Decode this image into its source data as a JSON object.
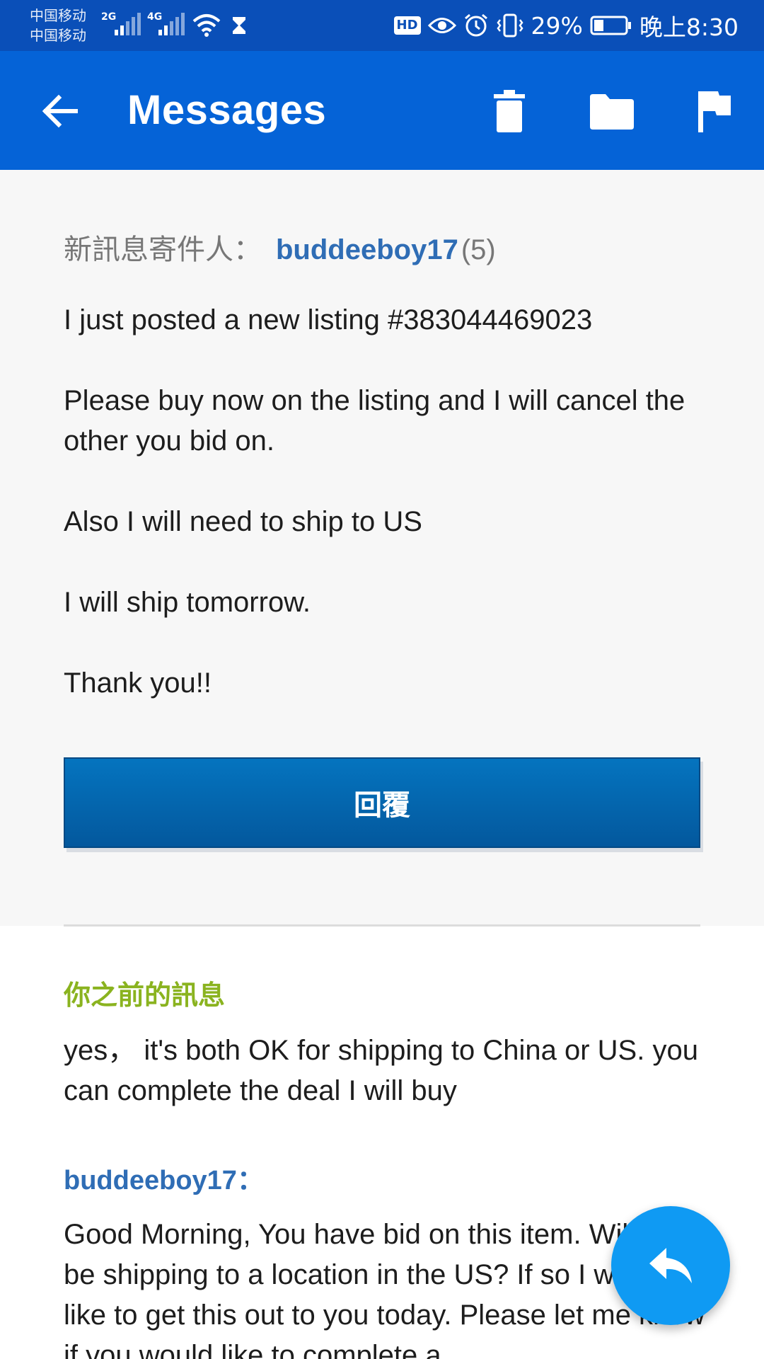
{
  "status_bar": {
    "carrier_1": "中国移动",
    "carrier_2": "中国移动",
    "network_1": "2G",
    "network_2": "4G",
    "hd_label": "HD",
    "battery": "29%",
    "time": "晚上8:30",
    "icons": [
      "signal-icon",
      "wifi-icon",
      "hourglass-icon",
      "eye-icon",
      "alarm-icon",
      "vibrate-icon",
      "battery-icon"
    ]
  },
  "app_bar": {
    "title": "Messages",
    "actions": [
      "back-arrow-icon",
      "trash-icon",
      "folder-icon",
      "flag-icon"
    ],
    "color": "#0563d7"
  },
  "message": {
    "sender_label": "新訊息寄件人：",
    "sender_name": "buddeeboy17",
    "sender_score": "(5)",
    "paragraphs": [
      "I just posted a new listing #383044469023",
      "Please buy now on the listing and I will cancel the other you bid on.",
      "Also I will need to ship to US",
      "I will ship tomorrow.",
      "Thank you!!"
    ],
    "reply_button": "回覆"
  },
  "history": {
    "previous_label": "你之前的訊息",
    "previous_text": "yes， it's both OK for shipping to China or US. you can complete the deal I will buy",
    "sender": "buddeeboy17：",
    "text": "Good Morning, You have bid on this item. Will you be shipping to a location in the US? If so I would like to get this out to you today. Please let me know if you would like to complete a"
  },
  "fab": {
    "icon": "reply-icon",
    "color": "#0f9af3"
  },
  "colors": {
    "status_bar": "#0a4fb8",
    "link_blue": "#2f6db5",
    "previous_label_green": "#8ab31f",
    "reply_button": "#0466b0"
  }
}
